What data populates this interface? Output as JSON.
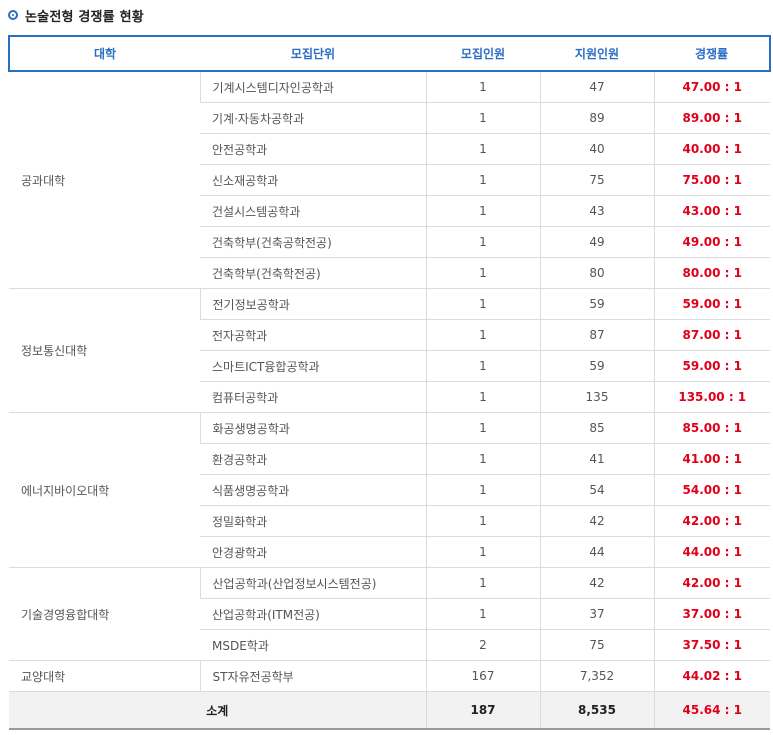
{
  "title": "논술전형 경쟁률 현황",
  "headers": [
    "대학",
    "모집단위",
    "모집인원",
    "지원인원",
    "경쟁률"
  ],
  "rows": [
    {
      "college": "공과대학",
      "span": 7,
      "unit": "기계시스템디자인공학과",
      "quota": "1",
      "applicants": "47",
      "rate": "47.00 : 1"
    },
    {
      "college": "",
      "unit": "기계·자동차공학과",
      "quota": "1",
      "applicants": "89",
      "rate": "89.00 : 1"
    },
    {
      "college": "",
      "unit": "안전공학과",
      "quota": "1",
      "applicants": "40",
      "rate": "40.00 : 1"
    },
    {
      "college": "",
      "unit": "신소재공학과",
      "quota": "1",
      "applicants": "75",
      "rate": "75.00 : 1"
    },
    {
      "college": "",
      "unit": "건설시스템공학과",
      "quota": "1",
      "applicants": "43",
      "rate": "43.00 : 1"
    },
    {
      "college": "",
      "unit": "건축학부(건축공학전공)",
      "quota": "1",
      "applicants": "49",
      "rate": "49.00 : 1"
    },
    {
      "college": "",
      "unit": "건축학부(건축학전공)",
      "quota": "1",
      "applicants": "80",
      "rate": "80.00 : 1"
    },
    {
      "college": "정보통신대학",
      "span": 4,
      "unit": "전기정보공학과",
      "quota": "1",
      "applicants": "59",
      "rate": "59.00 : 1"
    },
    {
      "college": "",
      "unit": "전자공학과",
      "quota": "1",
      "applicants": "87",
      "rate": "87.00 : 1"
    },
    {
      "college": "",
      "unit": "스마트ICT융합공학과",
      "quota": "1",
      "applicants": "59",
      "rate": "59.00 : 1"
    },
    {
      "college": "",
      "unit": "컴퓨터공학과",
      "quota": "1",
      "applicants": "135",
      "rate": "135.00 : 1"
    },
    {
      "college": "에너지바이오대학",
      "span": 5,
      "unit": "화공생명공학과",
      "quota": "1",
      "applicants": "85",
      "rate": "85.00 : 1"
    },
    {
      "college": "",
      "unit": "환경공학과",
      "quota": "1",
      "applicants": "41",
      "rate": "41.00 : 1"
    },
    {
      "college": "",
      "unit": "식품생명공학과",
      "quota": "1",
      "applicants": "54",
      "rate": "54.00 : 1"
    },
    {
      "college": "",
      "unit": "정밀화학과",
      "quota": "1",
      "applicants": "42",
      "rate": "42.00 : 1"
    },
    {
      "college": "",
      "unit": "안경광학과",
      "quota": "1",
      "applicants": "44",
      "rate": "44.00 : 1"
    },
    {
      "college": "기술경영융합대학",
      "span": 3,
      "unit": "산업공학과(산업정보시스템전공)",
      "quota": "1",
      "applicants": "42",
      "rate": "42.00 : 1"
    },
    {
      "college": "",
      "unit": "산업공학과(ITM전공)",
      "quota": "1",
      "applicants": "37",
      "rate": "37.00 : 1"
    },
    {
      "college": "",
      "unit": "MSDE학과",
      "quota": "2",
      "applicants": "75",
      "rate": "37.50 : 1"
    },
    {
      "college": "교양대학",
      "span": 1,
      "unit": "ST자유전공학부",
      "quota": "167",
      "applicants": "7,352",
      "rate": "44.02 : 1"
    }
  ],
  "total": {
    "label": "소계",
    "quota": "187",
    "applicants": "8,535",
    "rate": "45.64 : 1"
  },
  "colors": {
    "accent": "#2a6dc7",
    "rate": "#e0001b"
  }
}
